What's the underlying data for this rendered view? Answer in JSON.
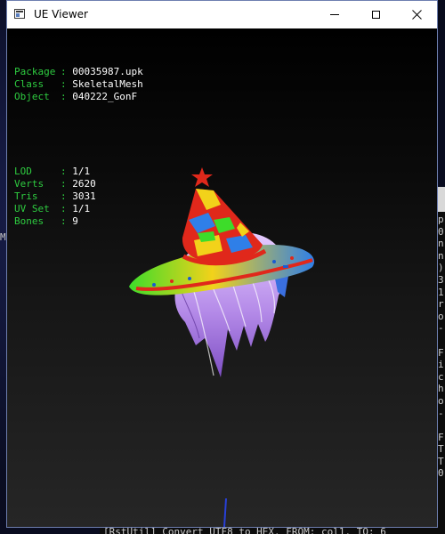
{
  "window": {
    "title": "UE Viewer"
  },
  "info": {
    "group1": [
      {
        "label": "Package",
        "value": "00035987.upk"
      },
      {
        "label": "Class",
        "value": "SkeletalMesh"
      },
      {
        "label": "Object",
        "value": "040222_GonF"
      }
    ],
    "group2": [
      {
        "label": "LOD",
        "value": "1/1"
      },
      {
        "label": "Verts",
        "value": "2620"
      },
      {
        "label": "Tris",
        "value": "3031"
      },
      {
        "label": "UV Set",
        "value": "1/1"
      },
      {
        "label": "Bones",
        "value": "9"
      }
    ]
  },
  "desktop": {
    "edge_letter": "M"
  },
  "console": {
    "lines": "p\n0\nn\nn\n)\n3\n1\nr\no\n-\n\nF\ni\nc\nh\no\n-\n\nF\nT\nT\n0",
    "bottom_text": "[RstUtil] Convert UTF8 to HEX. FROM: col1. TO: 6"
  },
  "colors": {
    "label_green": "#2ecc40",
    "value_white": "#ffffff",
    "viewport_bg": "#1f1f1f"
  },
  "icons": {
    "app": "ue-viewer-app-icon",
    "minimize": "minimize-icon",
    "maximize": "maximize-icon",
    "close": "close-icon"
  }
}
